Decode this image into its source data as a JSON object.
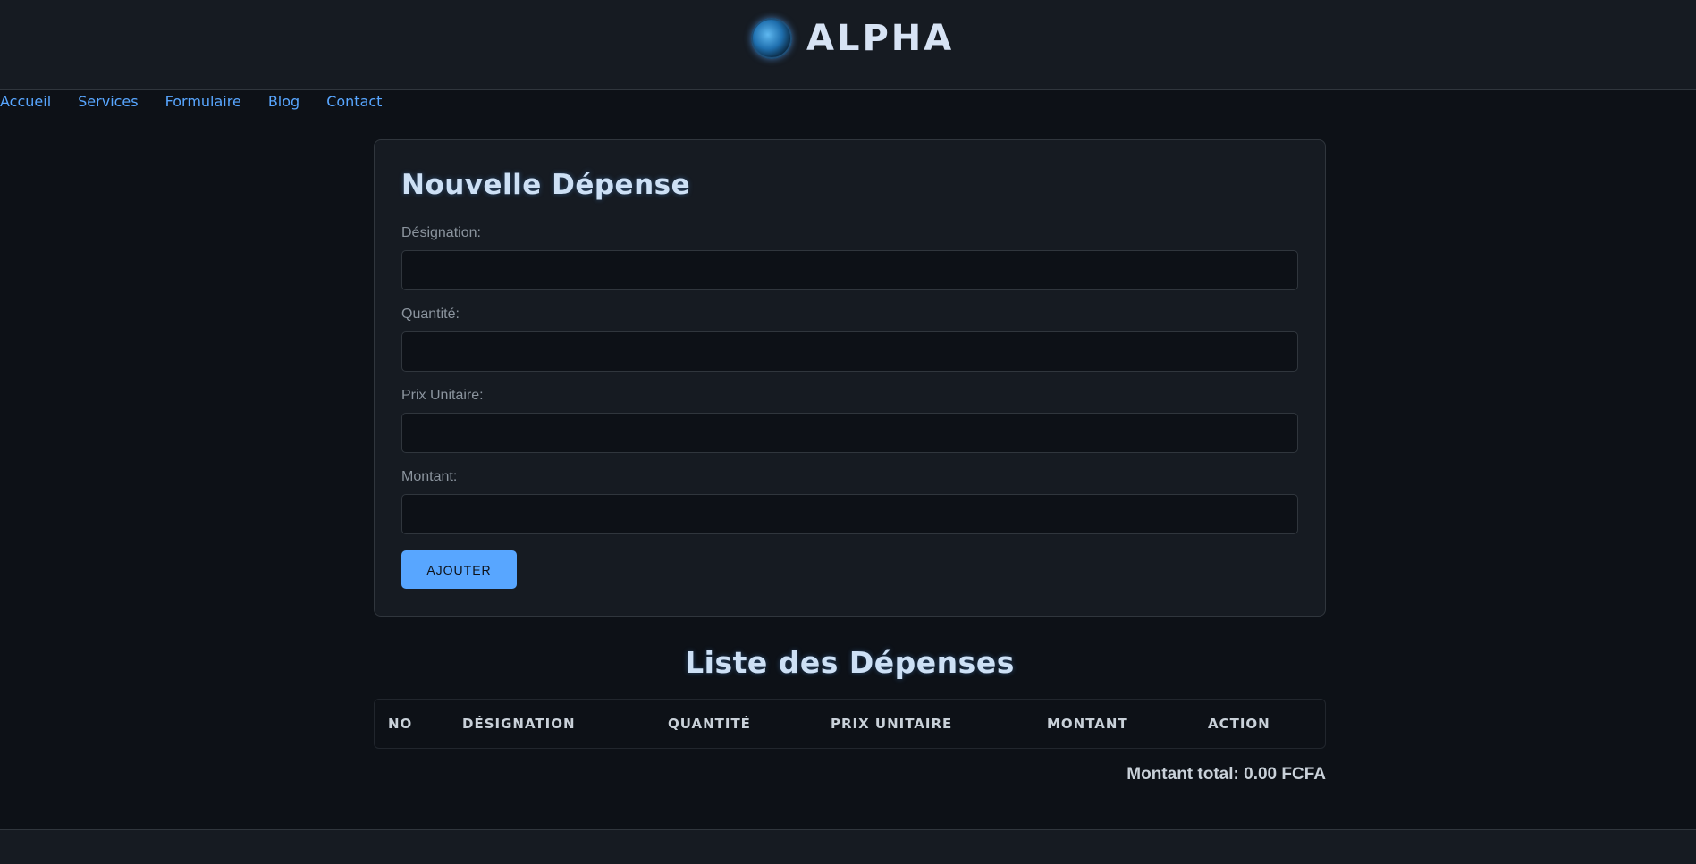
{
  "header": {
    "logo_icon": "globe-logo-icon",
    "brand_name": "ALPHA"
  },
  "nav": {
    "items": [
      {
        "label": "Accueil"
      },
      {
        "label": "Services"
      },
      {
        "label": "Formulaire"
      },
      {
        "label": "Blog"
      },
      {
        "label": "Contact"
      }
    ]
  },
  "form": {
    "title": "Nouvelle Dépense",
    "fields": [
      {
        "label": "Désignation:",
        "value": ""
      },
      {
        "label": "Quantité:",
        "value": ""
      },
      {
        "label": "Prix Unitaire:",
        "value": ""
      },
      {
        "label": "Montant:",
        "value": ""
      }
    ],
    "submit_label": "AJOUTER"
  },
  "list": {
    "title": "Liste des Dépenses",
    "columns": [
      "No",
      "Désignation",
      "Quantité",
      "Prix Unitaire",
      "Montant",
      "Action"
    ],
    "rows": [],
    "total_text": "Montant total: 0.00 FCFA"
  },
  "colors": {
    "accent": "#58a6ff",
    "background": "#0d1117",
    "surface": "#161b22",
    "border": "#30363d"
  }
}
